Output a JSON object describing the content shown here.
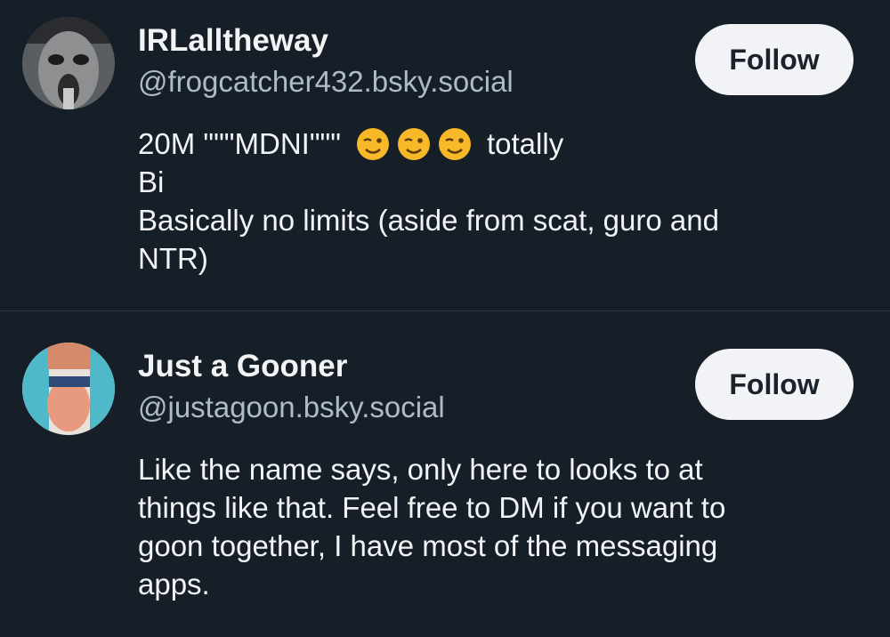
{
  "results": [
    {
      "display_name": "IRLalltheway",
      "handle": "@frogcatcher432.bsky.social",
      "follow_label": "Follow",
      "bio_lines": [
        "20M \"\"\"MDNI\"\"\"",
        "totally",
        "Bi",
        "Basically no limits (aside from scat, guro and",
        "NTR)"
      ],
      "bio_emoji": "winking-face-emoji"
    },
    {
      "display_name": "Just a Gooner",
      "handle": "@justagoon.bsky.social",
      "follow_label": "Follow",
      "bio_lines": [
        "Like the name says, only here to looks to at",
        "things like that. Feel free to DM if you want to",
        "goon together, I have most of the messaging",
        "apps."
      ]
    }
  ],
  "colors": {
    "background": "#161e27",
    "handle": "#aebbc9",
    "button_bg": "#f1f3f6",
    "divider": "#2e3a47"
  }
}
